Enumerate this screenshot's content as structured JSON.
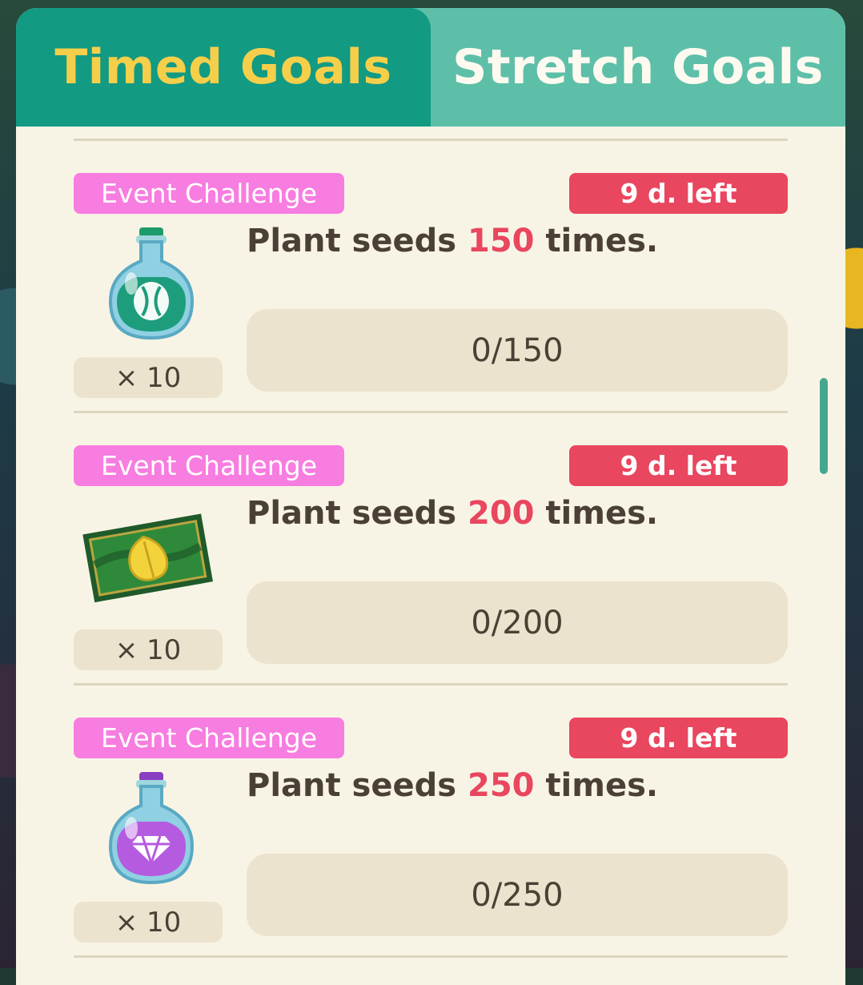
{
  "tabs": {
    "timed_goals": "Timed Goals",
    "stretch_goals": "Stretch Goals"
  },
  "goals": [
    {
      "badge": "Event Challenge",
      "time_left": "9 d. left",
      "desc_prefix": "Plant seeds",
      "target": "150",
      "desc_suffix": "times.",
      "progress_text": "0/150",
      "progress_fraction": 0,
      "reward_qty": "× 10",
      "reward_icon": "green-potion-icon"
    },
    {
      "badge": "Event Challenge",
      "time_left": "9 d. left",
      "desc_prefix": "Plant seeds",
      "target": "200",
      "desc_suffix": "times.",
      "progress_text": "0/200",
      "progress_fraction": 0,
      "reward_qty": "× 10",
      "reward_icon": "leaf-ticket-icon"
    },
    {
      "badge": "Event Challenge",
      "time_left": "9 d. left",
      "desc_prefix": "Plant seeds",
      "target": "250",
      "desc_suffix": "times.",
      "progress_text": "0/250",
      "progress_fraction": 0,
      "reward_qty": "× 10",
      "reward_icon": "purple-potion-icon"
    }
  ],
  "colors": {
    "tab_active": "#129a83",
    "tab_inactive": "#5ebfa9",
    "tab_active_text": "#f5cf4a",
    "badge_event": "#f77de0",
    "badge_time": "#e9465f",
    "highlight_number": "#e9465f",
    "panel_bg": "#f8f4e5"
  }
}
